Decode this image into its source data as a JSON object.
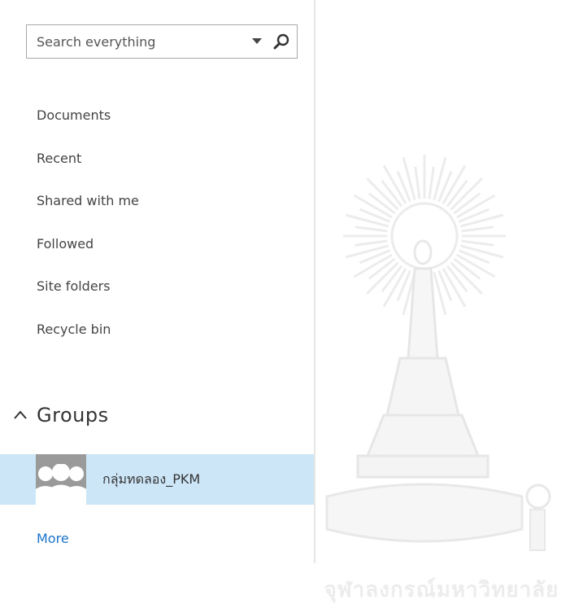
{
  "search": {
    "placeholder": "Search everything",
    "dropdown_icon": "chevron-down-icon",
    "search_icon": "search-icon"
  },
  "nav": {
    "items": [
      {
        "label": "Documents"
      },
      {
        "label": "Recent"
      },
      {
        "label": "Shared with me"
      },
      {
        "label": "Followed"
      },
      {
        "label": "Site folders"
      },
      {
        "label": "Recycle bin"
      }
    ]
  },
  "groups": {
    "title": "Groups",
    "expanded": true,
    "items": [
      {
        "name": "กลุ่มทดลอง_PKM",
        "selected": true
      }
    ],
    "more_label": "More"
  },
  "watermark": {
    "caption": "จุฬาลงกรณ์มหาวิทยาลัย"
  },
  "colors": {
    "selected_row": "#cde6f7",
    "link": "#1a73c8",
    "text": "#444444"
  }
}
